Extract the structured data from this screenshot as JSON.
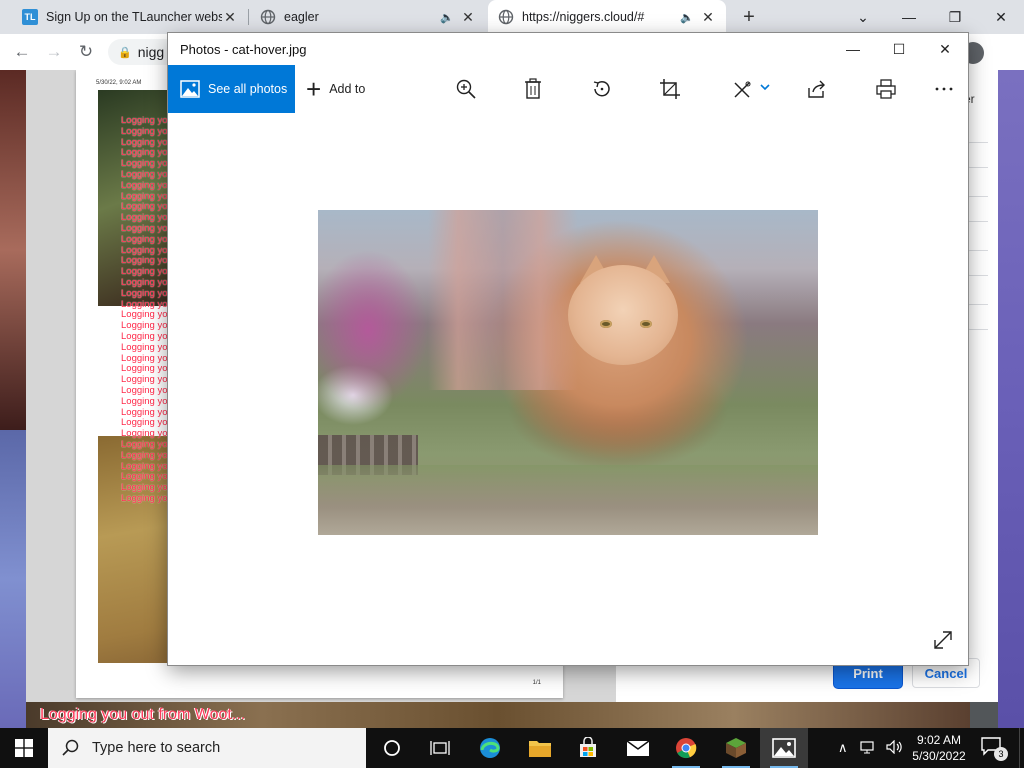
{
  "browser": {
    "tabs": [
      {
        "title": "Sign Up on the TLauncher website",
        "favicon": "tlauncher-logo",
        "favicon_text": "TL"
      },
      {
        "title": "eagler",
        "favicon": "globe-icon"
      },
      {
        "title": "https://niggers.cloud/#",
        "favicon": "globe-icon"
      }
    ],
    "address_text": "nigg",
    "colors": {
      "tab_strip": "#dee1e6",
      "accent": "#1a73e8"
    }
  },
  "print_preview": {
    "page_date": "5/30/22, 9:02 AM",
    "page_number": "1/1",
    "log_lines": [
      "Logging yo",
      "Logging yo",
      "Logging yo",
      "Logging yo",
      "Logging yo",
      "Logging yo",
      "Logging yo",
      "Logging yo",
      "Logging yo",
      "Logging yo",
      "Logging yo",
      "Logging yo",
      "Logging yo",
      "Logging yo",
      "Logging yo",
      "Logging yo",
      "Logging yo",
      "Logging yo",
      "Logging yo",
      "Logging yo",
      "Logging yo",
      "Logging yo",
      "Logging yo",
      "Logging yo",
      "Logging yo",
      "Logging yo",
      "Logging yo",
      "Logging yo",
      "Logging yo",
      "Logging yo",
      "Logging yo",
      "Logging yo",
      "Logging yo",
      "Logging yo",
      "Logging yo",
      "Logging yo"
    ],
    "panel_partial_label": "er",
    "print_label": "Print",
    "cancel_label": "Cancel"
  },
  "overlay": {
    "text": "Logging you out from Woot..."
  },
  "photos": {
    "title": "Photos - cat-hover.jpg",
    "see_all_label": "See all photos",
    "add_to_label": "Add to",
    "toolbar_icons": [
      "zoom-in-icon",
      "delete-icon",
      "rotate-icon",
      "crop-icon",
      "edit-icon",
      "share-icon",
      "print-icon",
      "more-icon"
    ],
    "accent": "#0078d7"
  },
  "taskbar": {
    "search_placeholder": "Type here to search",
    "time": "9:02 AM",
    "date": "5/30/2022",
    "notification_count": "3"
  }
}
